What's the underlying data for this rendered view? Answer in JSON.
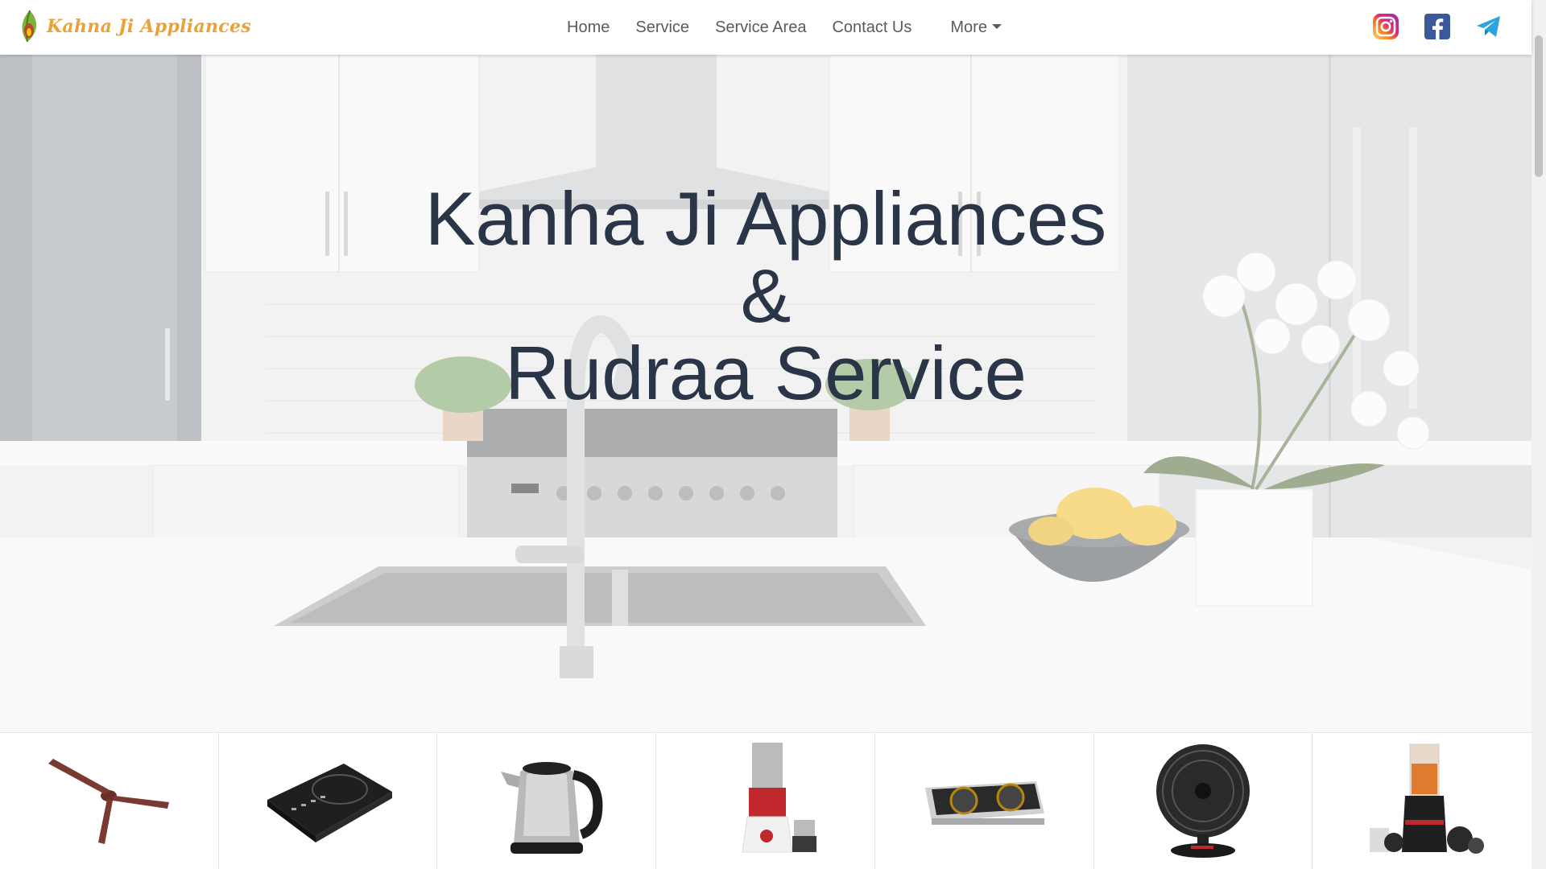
{
  "brand": {
    "name": "Kahna Ji Appliances",
    "logo_icon": "leaf-logo-icon"
  },
  "nav": {
    "items": [
      {
        "label": "Home"
      },
      {
        "label": "Service"
      },
      {
        "label": "Service Area"
      },
      {
        "label": "Contact Us"
      }
    ],
    "more_label": "More"
  },
  "social": [
    "instagram-icon",
    "facebook-icon",
    "telegram-icon"
  ],
  "hero": {
    "line1": "Kanha Ji Appliances",
    "line2": "&",
    "line3": "Rudraa Service"
  },
  "products": [
    {
      "icon": "ceiling-fan-icon"
    },
    {
      "icon": "induction-cooktop-icon"
    },
    {
      "icon": "electric-kettle-icon"
    },
    {
      "icon": "mixer-grinder-icon"
    },
    {
      "icon": "gas-stove-icon"
    },
    {
      "icon": "table-fan-icon"
    },
    {
      "icon": "blender-icon"
    }
  ],
  "colors": {
    "brand_orange": "#e8a23a",
    "nav_text": "#5b5b5b",
    "hero_text": "#2a3547",
    "facebook_blue": "#3b5998",
    "telegram_blue": "#2aa3df"
  }
}
